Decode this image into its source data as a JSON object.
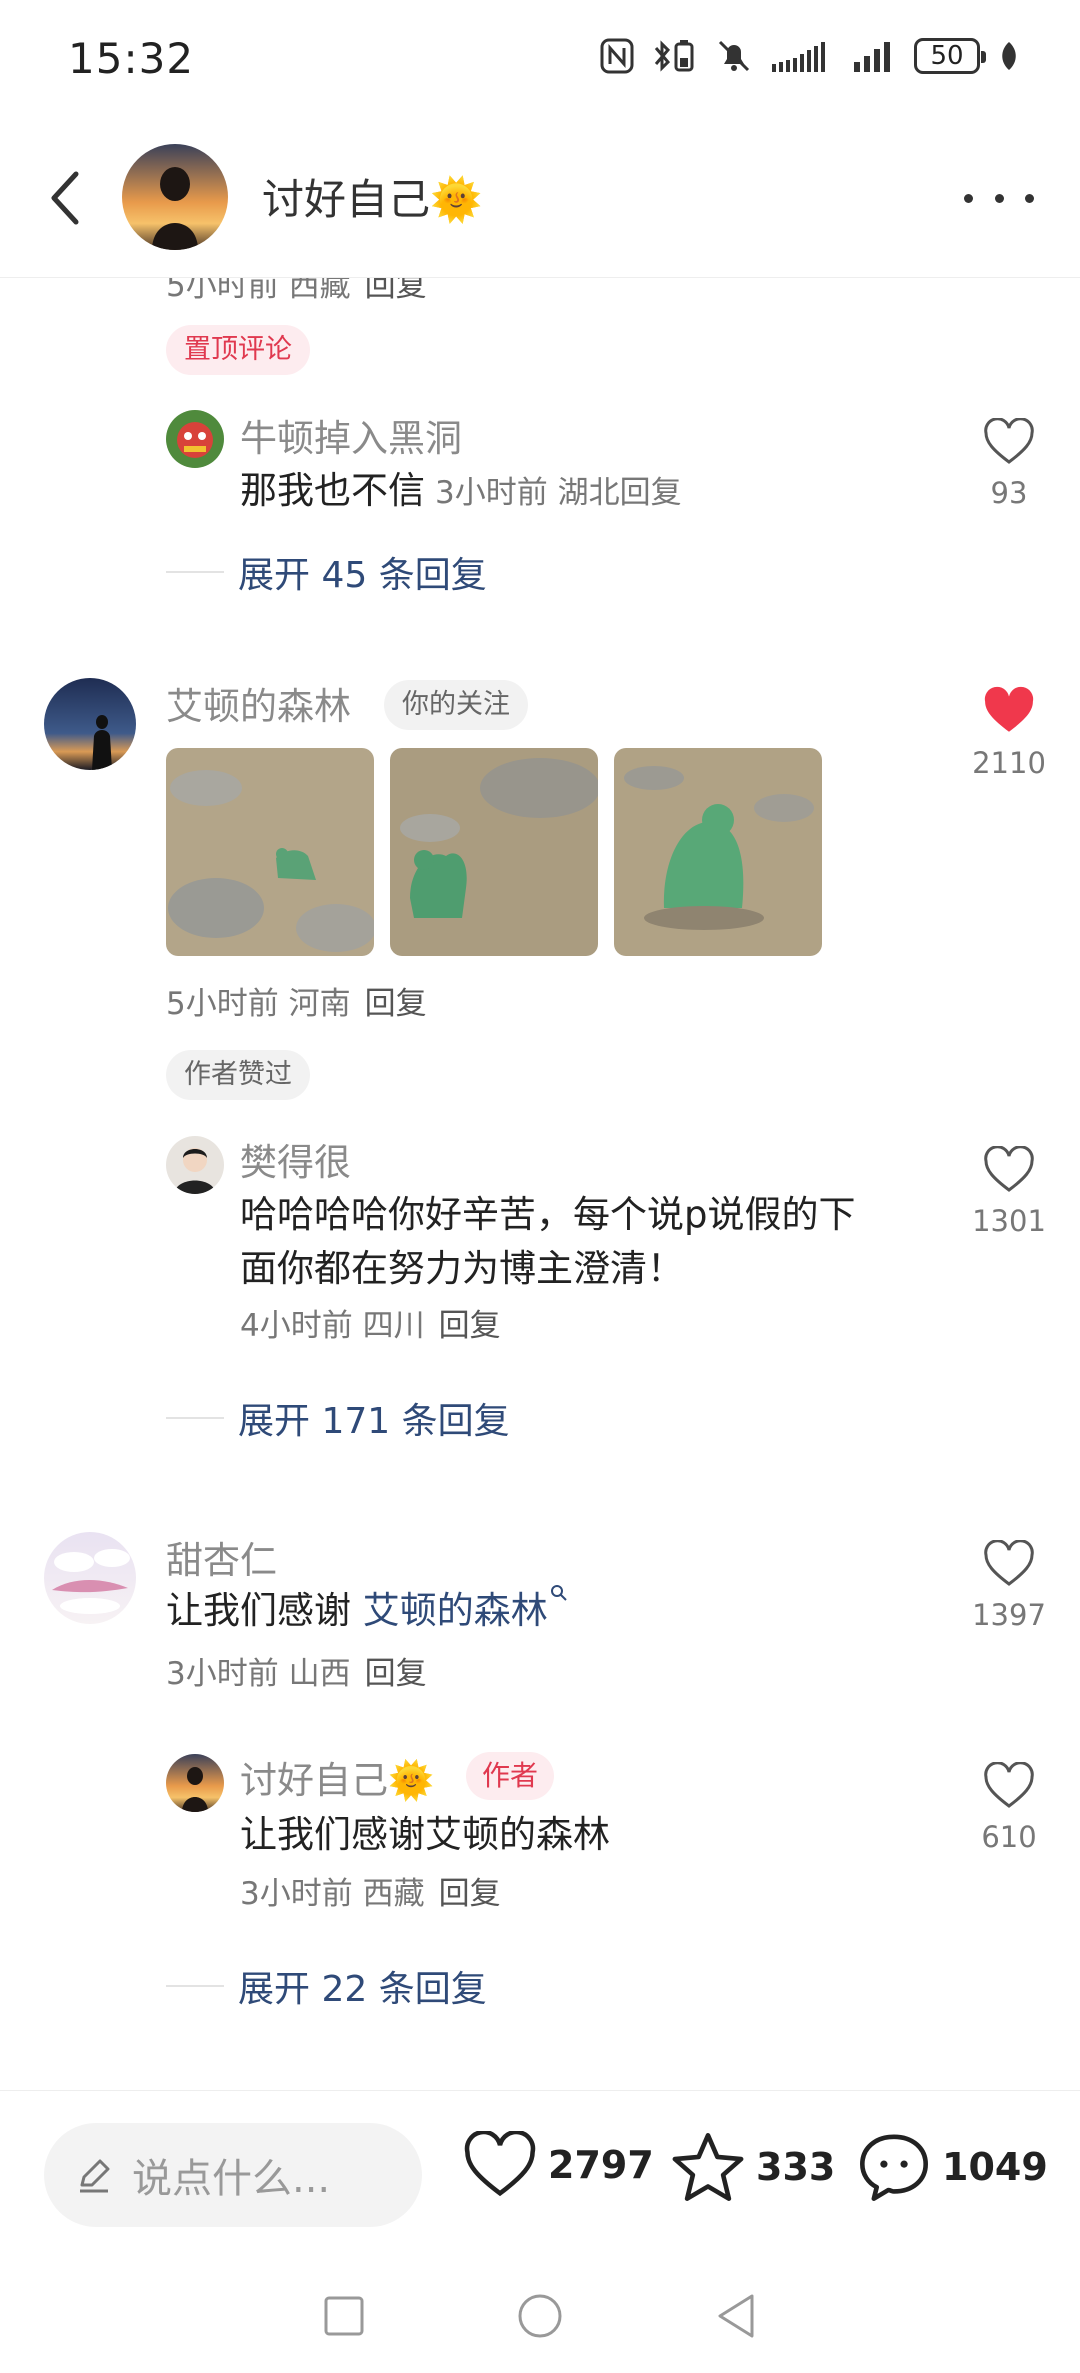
{
  "status_bar": {
    "time": "15:32",
    "battery": "50"
  },
  "header": {
    "title": "讨好自己🌞"
  },
  "comments": {
    "first": {
      "partial_meta": "5小时前 西藏",
      "reply": "回复",
      "badge": "置顶评论",
      "sub_reply": {
        "name": "牛顿掉入黑洞",
        "text": "那我也不信",
        "meta": "3小时前 湖北",
        "reply": "回复",
        "likes": "93"
      },
      "expand": "展开 45 条回复"
    },
    "second": {
      "name": "艾顿的森林",
      "tag": "你的关注",
      "likes": "2110",
      "meta": "5小时前 河南",
      "reply": "回复",
      "badge": "作者赞过",
      "sub_reply": {
        "name": "樊得很",
        "text_line1": "哈哈哈哈你好辛苦，每个说p说假的下",
        "text_line2": "面你都在努力为博主澄清！",
        "meta": "4小时前 四川",
        "reply": "回复",
        "likes": "1301"
      },
      "expand": "展开 171 条回复"
    },
    "third": {
      "name": "甜杏仁",
      "text_prefix": "让我们感谢 ",
      "mention": "艾顿的森林",
      "likes": "1397",
      "meta": "3小时前 山西",
      "reply": "回复",
      "sub_reply": {
        "name": "讨好自己🌞",
        "author_badge": "作者",
        "text": "让我们感谢艾顿的森林",
        "meta": "3小时前 西藏",
        "reply": "回复",
        "likes": "610"
      },
      "expand": "展开 22 条回复"
    }
  },
  "bottom_bar": {
    "placeholder": "说点什么...",
    "likes": "2797",
    "favorites": "333",
    "comments": "1049"
  },
  "colors": {
    "accent_red": "#e0394f",
    "link_blue": "#2f4a78",
    "liked_heart": "#f0384c"
  }
}
